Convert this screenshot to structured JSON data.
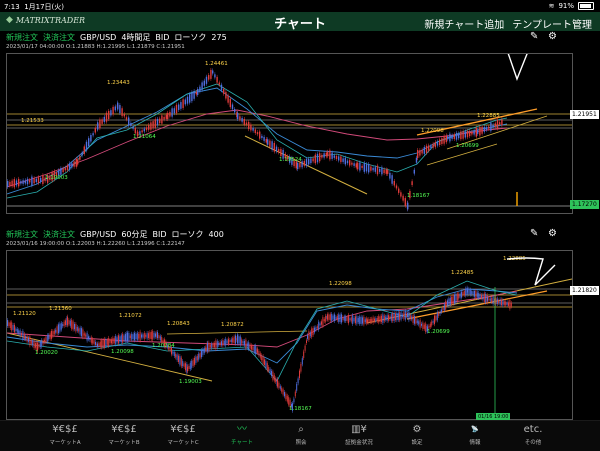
{
  "status": {
    "time": "7:13",
    "date": "1月17日(火)",
    "battery": "91%"
  },
  "header": {
    "logo": "MATRIXTRADER",
    "title": "チャート",
    "add_chart": "新規チャート追加",
    "template": "テンプレート管理"
  },
  "chart1": {
    "new_order": "新規注文",
    "settle_order": "決済注文",
    "pair": "GBP/USD",
    "timeframe": "4時間足",
    "side": "BID",
    "type": "ローソク",
    "count": "275",
    "ohlc": "2023/01/17 04:00:00  O:1.21883 H:1.21995 L:1.21879 C:1.21951",
    "price_now": "1.21951",
    "price_low": "1.17270",
    "labels": {
      "a": "1.24461",
      "b": "1.23443",
      "c": "1.21533",
      "d": "1.21064",
      "e": "1.19003",
      "f": "1.19524",
      "g": "1.18167",
      "h": "1.22098",
      "i": "1.22885",
      "j": "1.20699"
    }
  },
  "chart2": {
    "new_order": "新規注文",
    "settle_order": "決済注文",
    "pair": "GBP/USD",
    "timeframe": "60分足",
    "side": "BID",
    "type": "ローソク",
    "count": "400",
    "ohlc": "2023/01/16 19:00:00  O:1.22003 H:1.22260 L:1.21996 C:1.22147",
    "price_now": "1.21820",
    "cursor_time": "01/16 19:00",
    "labels": {
      "a": "1.21120",
      "b": "1.21360",
      "c": "1.20020",
      "d": "1.21072",
      "e": "1.20098",
      "f": "1.20843",
      "g": "1.20284",
      "h": "1.20872",
      "i": "1.19003",
      "j": "1.18167",
      "k": "1.22098",
      "l": "1.22485",
      "m": "1.22885",
      "n": "1.20699"
    }
  },
  "tabs": [
    {
      "label": "マーケットA",
      "icon": "¥€$£"
    },
    {
      "label": "マーケットB",
      "icon": "¥€$£"
    },
    {
      "label": "マーケットC",
      "icon": "¥€$£"
    },
    {
      "label": "チャート",
      "icon": "chart"
    },
    {
      "label": "照会",
      "icon": "search"
    },
    {
      "label": "証拠金状況",
      "icon": "margin"
    },
    {
      "label": "設定",
      "icon": "gear"
    },
    {
      "label": "情報",
      "icon": "NEWS"
    },
    {
      "label": "その他",
      "icon": "etc."
    }
  ]
}
